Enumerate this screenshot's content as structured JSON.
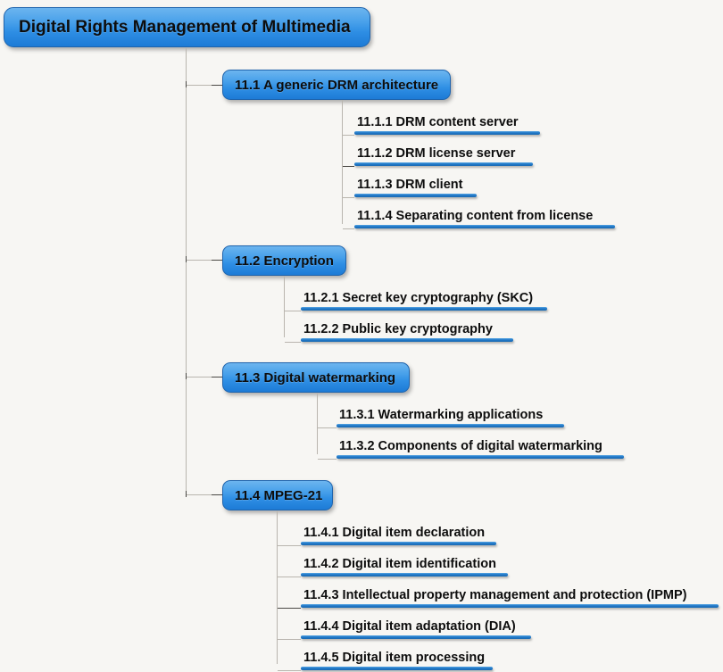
{
  "background_color": "#f7f6f3",
  "node_color": "#2e8ee4",
  "node_border_color": "#1f64ad",
  "leaf_bar_color": "#2079c8",
  "connector_color": "#b9b5ae",
  "root": {
    "label": "Digital Rights Management of Multimedia"
  },
  "branches": [
    {
      "label": "11.1 A generic DRM architecture",
      "children": [
        {
          "label": "11.1.1 DRM content server"
        },
        {
          "label": "11.1.2 DRM license server"
        },
        {
          "label": "11.1.3 DRM client"
        },
        {
          "label": "11.1.4 Separating content from license"
        }
      ]
    },
    {
      "label": "11.2 Encryption",
      "children": [
        {
          "label": "11.2.1 Secret key cryptography (SKC)"
        },
        {
          "label": "11.2.2 Public key cryptography"
        }
      ]
    },
    {
      "label": "11.3 Digital watermarking",
      "children": [
        {
          "label": "11.3.1 Watermarking applications"
        },
        {
          "label": "11.3.2 Components of digital watermarking"
        }
      ]
    },
    {
      "label": "11.4 MPEG-21",
      "children": [
        {
          "label": "11.4.1 Digital item declaration"
        },
        {
          "label": "11.4.2 Digital item identification"
        },
        {
          "label": "11.4.3 Intellectual property management and protection (IPMP)"
        },
        {
          "label": "11.4.4 Digital item adaptation (DIA)"
        },
        {
          "label": "11.4.5 Digital item processing"
        }
      ]
    }
  ]
}
